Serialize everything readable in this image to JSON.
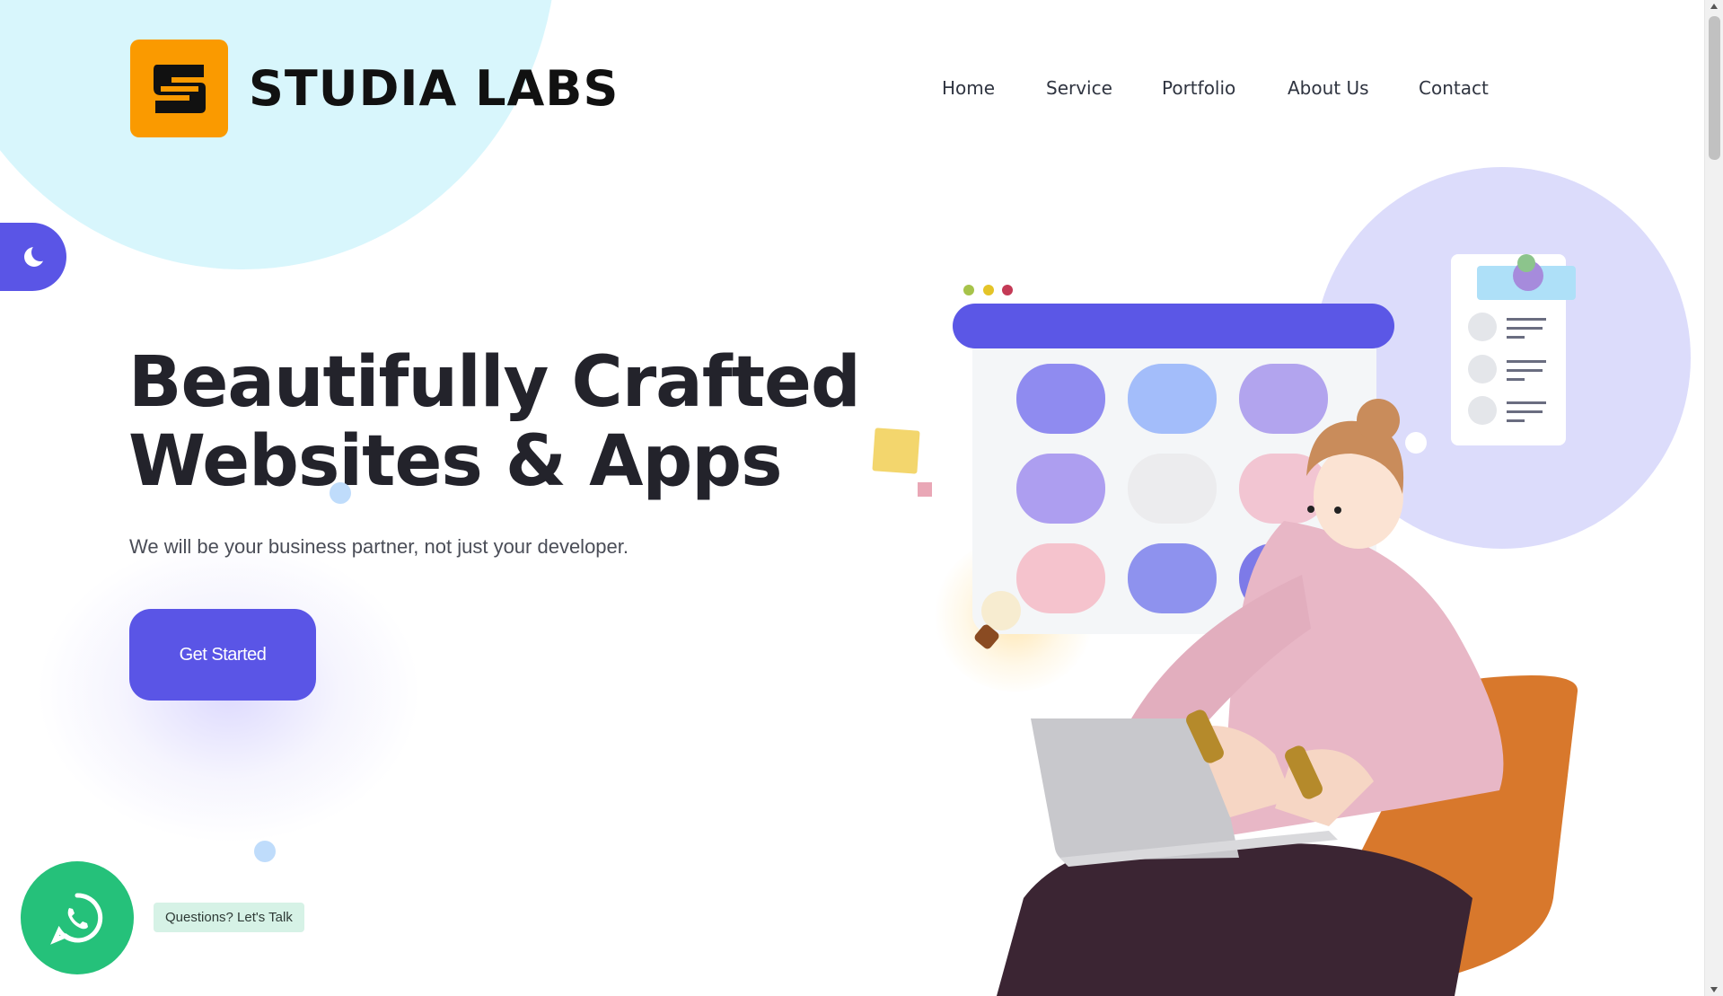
{
  "brand": {
    "name": "STUDIA LABS",
    "logo_icon": "studia-s-logo",
    "logo_color": "#fa9a00"
  },
  "nav": {
    "items": [
      {
        "label": "Home"
      },
      {
        "label": "Service"
      },
      {
        "label": "Portfolio"
      },
      {
        "label": "About Us"
      },
      {
        "label": "Contact"
      }
    ]
  },
  "theme_toggle": {
    "icon": "moon-icon",
    "color": "#5a55e6"
  },
  "hero": {
    "title_line1": "Beautifully Crafted",
    "title_line2": "Websites & Apps",
    "subtitle": "We will be your business partner, not just your developer.",
    "cta_label": "Get Started"
  },
  "whatsapp": {
    "icon": "whatsapp-icon",
    "label": "Questions? Let's Talk",
    "color": "#25c17a"
  },
  "colors": {
    "accent": "#5a55e6",
    "text": "#23232b",
    "blob_cyan": "#d8f6fc",
    "blob_lilac": "#dcdcfb"
  }
}
